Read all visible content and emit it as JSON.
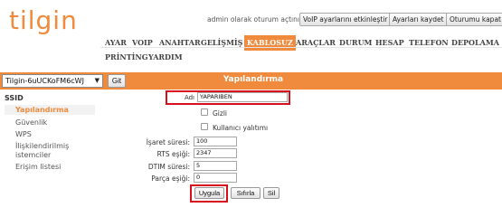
{
  "brand": {
    "logo_text": "tilgin",
    "accent_color": "#f08a3c",
    "highlight_color": "#d8101e"
  },
  "status": {
    "text": "admin olarak oturum açtınız.",
    "buttons": [
      "VoIP ayarlarını etkinleştir",
      "Ayarları kaydet",
      "Oturumu kapat"
    ]
  },
  "nav": {
    "row1": [
      "AYAR",
      "VOIP",
      "ANAHTAR",
      "GELİŞMİŞ",
      "KABLOSUZ",
      "ARAÇLAR",
      "DURUM",
      "HESAP",
      "TELEFON",
      "DEPOLAMA"
    ],
    "row2": [
      "PRİNTİNG",
      "YARDIM"
    ],
    "active": "KABLOSUZ"
  },
  "toolbar": {
    "ssid_select": "Tilgin-6uUCKoFM6cWJ",
    "go_button": "Git",
    "title": "Yapılandırma"
  },
  "sidebar": {
    "heading": "SSID",
    "items": [
      "Yapılandırma",
      "Güvenlik",
      "WPS",
      "İlişkilendirilmiş istemciler",
      "Erişim listesi"
    ],
    "active_index": 0
  },
  "form": {
    "name_label": "Adı",
    "name_value": "YAPARIBEN",
    "hidden_label": "Gizli",
    "isolation_label": "Kullanıcı yalıtımı",
    "signal_label": "İşaret süresi:",
    "signal_value": "100",
    "rts_label": "RTS eşiği:",
    "rts_value": "2347",
    "dtim_label": "DTIM süresi:",
    "dtim_value": "5",
    "frag_label": "Parça eşiği:",
    "frag_value": "0",
    "apply_button": "Uygula",
    "reset_button": "Sıfırla",
    "delete_button": "Sil"
  }
}
